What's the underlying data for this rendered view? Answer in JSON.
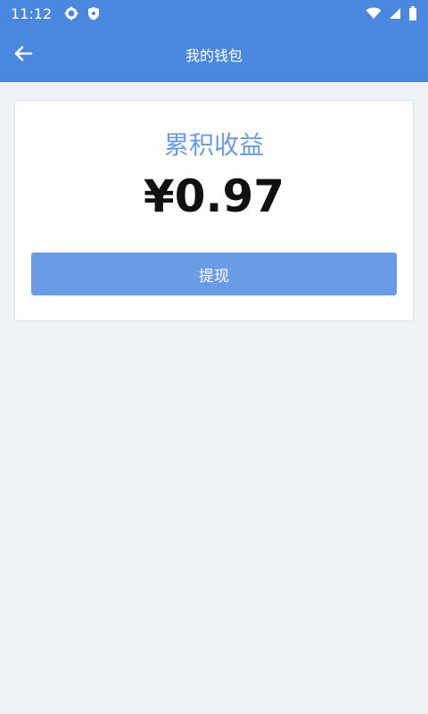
{
  "status_bar": {
    "time": "11:12",
    "icons": [
      "gear-icon",
      "shield-icon",
      "wifi-icon",
      "signal-icon",
      "battery-icon"
    ]
  },
  "app_bar": {
    "title": "我的钱包",
    "back_icon": "arrow-left-icon"
  },
  "wallet": {
    "label": "累积收益",
    "amount": "¥0.97",
    "withdraw_label": "提现"
  },
  "colors": {
    "primary": "#4a88e0",
    "accent": "#6a9be6",
    "background": "#eef1f5"
  }
}
